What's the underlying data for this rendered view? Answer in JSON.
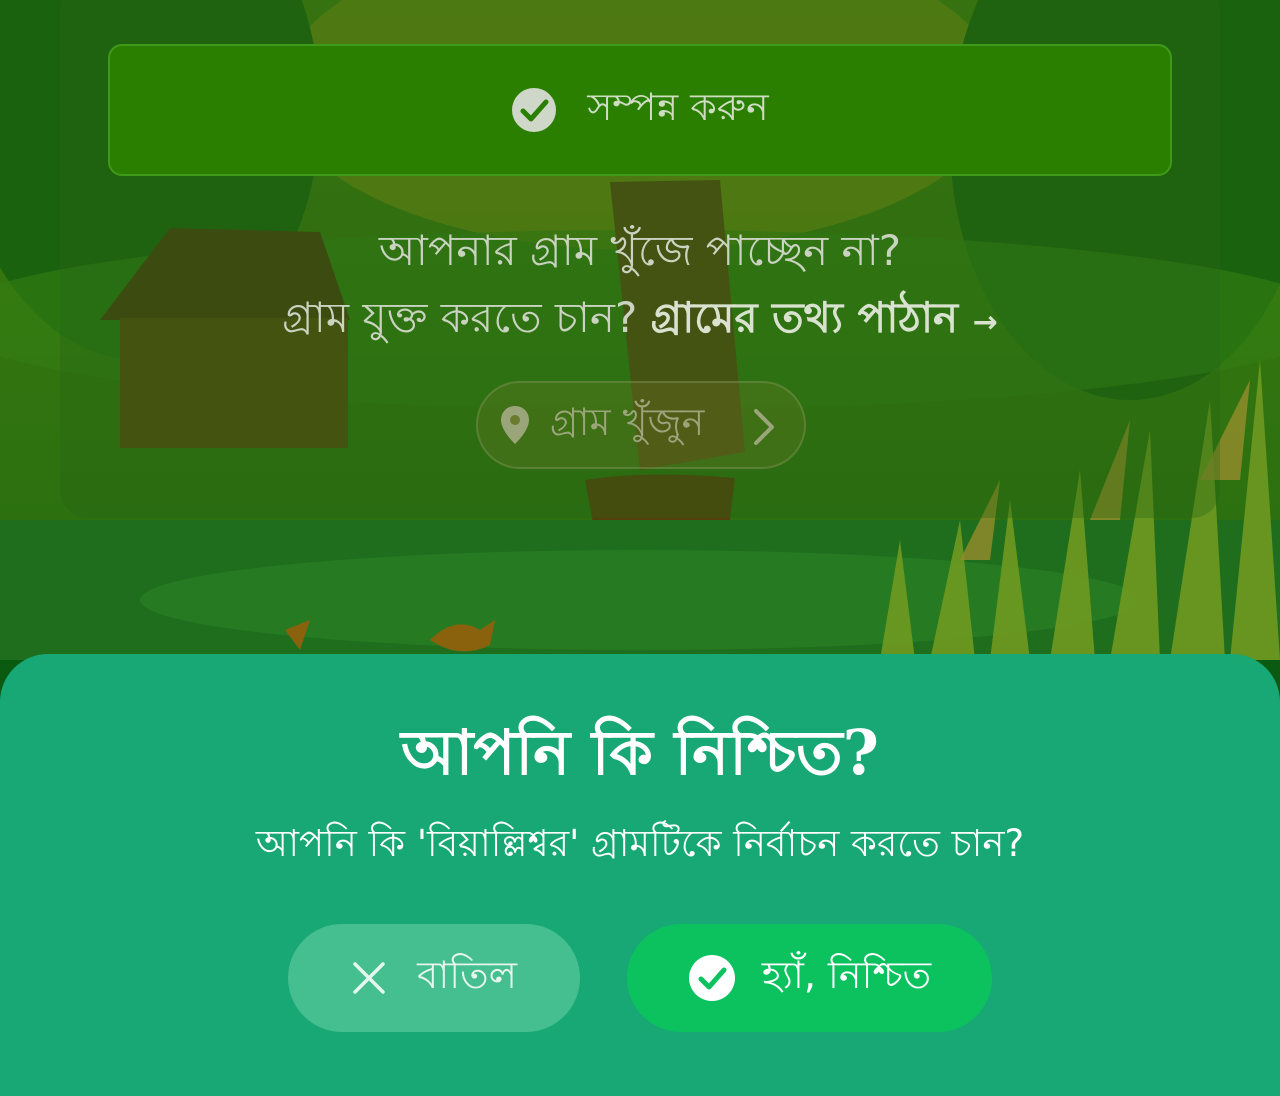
{
  "card": {
    "complete_button": {
      "label": "সম্পন্ন করুন",
      "icon": "check-circle-icon"
    },
    "not_found_text": "আপনার গ্রাম খুঁজে পাচ্ছেন না?",
    "add_prompt": "গ্রাম যুক্ত করতে চান?",
    "send_info_link": "গ্রামের তথ্য পাঠান",
    "send_info_arrow": "→",
    "search_button": {
      "label": "গ্রাম খুঁজুন",
      "icon": "location-pin-icon",
      "trailing_icon": "chevron-right-icon"
    }
  },
  "dialog": {
    "title": "আপনি কি নিশ্চিত?",
    "message": "আপনি কি 'বিয়াল্লিশ্বর' গ্রামটিকে নির্বাচন করতে চান?",
    "cancel": {
      "label": "বাতিল",
      "icon": "close-icon"
    },
    "confirm": {
      "label": "হ্যাঁ, নিশ্চিত",
      "icon": "check-circle-icon"
    }
  },
  "colors": {
    "sheet": "#17a876",
    "confirm_button": "#0cc25f",
    "cancel_button": "#45bf8f",
    "complete_button": "#2a7f00"
  }
}
